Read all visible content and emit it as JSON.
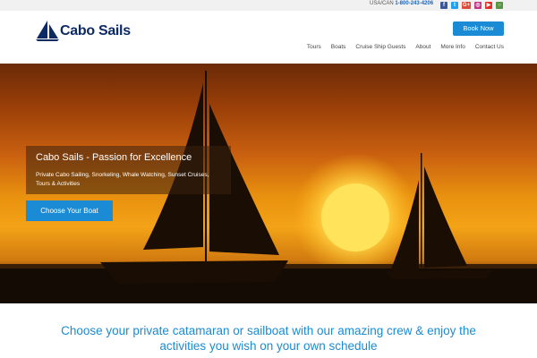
{
  "topbar": {
    "phone_prefix": "USA/CAN",
    "phone_number": "1-800-243-4206",
    "social_icons": [
      "facebook-icon",
      "twitter-icon",
      "google-plus-icon",
      "instagram-icon",
      "youtube-icon",
      "tripadvisor-icon"
    ]
  },
  "header": {
    "logo_text": "Cabo Sails",
    "book_button": "Book Now"
  },
  "nav": {
    "items": [
      "Tours",
      "Boats",
      "Cruise Ship Guests",
      "About",
      "More Info",
      "Contact Us"
    ]
  },
  "hero": {
    "title": "Cabo Sails - Passion for Excellence",
    "subtitle": "Private Cabo Sailing, Snorkeling, Whale Watching, Sunset Cruises, Tours & Activities",
    "cta": "Choose Your Boat"
  },
  "tagline": {
    "line1": "Choose your private catamaran or sailboat with our amazing crew & enjoy the",
    "line2": "activities you wish on your own schedule"
  },
  "colors": {
    "accent": "#1a8bd4",
    "brand": "#0d2a63",
    "phone": "#1565c0"
  }
}
